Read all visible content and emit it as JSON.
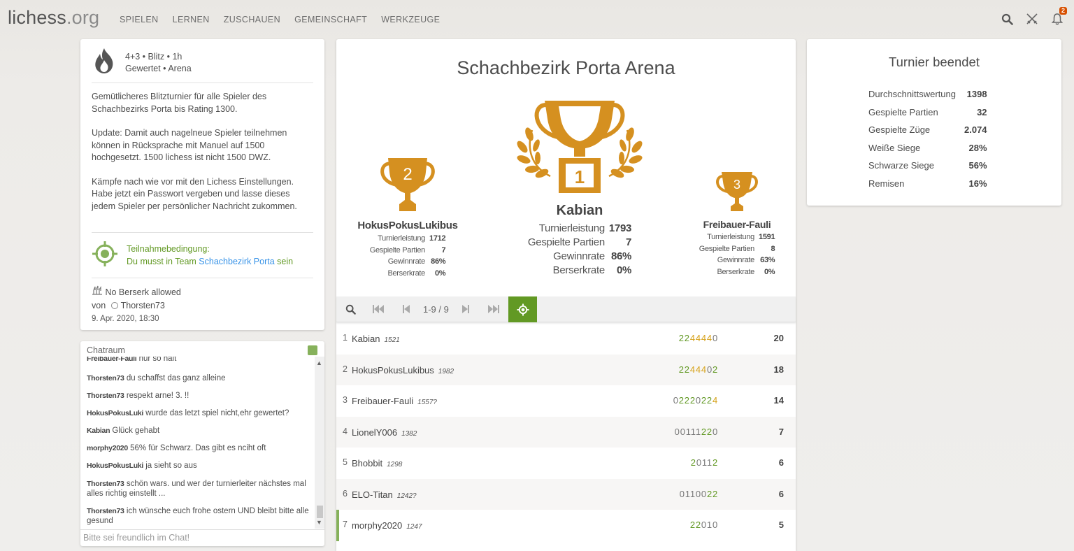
{
  "header": {
    "logo_main": "lichess",
    "logo_tld": ".org",
    "nav": [
      "SPIELEN",
      "LERNEN",
      "ZUSCHAUEN",
      "GEMEINSCHAFT",
      "WERKZEUGE"
    ],
    "notification_count": "2"
  },
  "info": {
    "line1": "4+3 • Blitz • 1h",
    "line2": "Gewertet • Arena",
    "desc1": "Gemütlicheres Blitzturnier für alle Spieler des Schachbezirks Porta bis Rating 1300.",
    "desc2": "Update: Damit auch nagelneue Spieler teilnehmen können in Rücksprache mit Manuel auf 1500 hochgesetzt. 1500 lichess ist nicht 1500 DWZ.",
    "desc3": "Kämpfe nach wie vor mit den Lichess Einstellungen. Habe jetzt ein Passwort vergeben und lasse dieses jedem Spieler per persönlicher Nachricht zukommen.",
    "condition_title": "Teilnahmebedingung:",
    "condition_prefix": "Du musst in Team",
    "condition_team": "Schachbezirk Porta",
    "condition_suffix": "sein",
    "berserk": "No Berserk allowed",
    "by_label": "von",
    "by_user": "Thorsten73",
    "date": "9. Apr. 2020, 18:30"
  },
  "chat": {
    "title": "Chatraum",
    "placeholder": "Bitte sei freundlich im Chat!",
    "messages": [
      {
        "user": "Freibauer-Fauli",
        "text": "nur so halt"
      },
      {
        "user": "Thorsten73",
        "text": "du schaffst das ganz alleine"
      },
      {
        "user": "Thorsten73",
        "text": "respekt arne! 3. !!"
      },
      {
        "user": "HokusPokusLuki",
        "text": "wurde das letzt spiel nicht,ehr gewertet?"
      },
      {
        "user": "Kabian",
        "text": "Glück gehabt"
      },
      {
        "user": "morphy2020",
        "text": "56% für Schwarz. Das gibt es nciht oft"
      },
      {
        "user": "HokusPokusLuki",
        "text": "ja sieht so aus"
      },
      {
        "user": "Thorsten73",
        "text": "schön wars. und wer der turnierleiter nächstes mal alles richtig einstellt ..."
      },
      {
        "user": "Thorsten73",
        "text": "ich wünsche euch frohe ostern UND bleibt bitte alle gesund"
      }
    ]
  },
  "tournament": {
    "name": "Schachbezirk Porta Arena",
    "labels": {
      "perf": "Turnierleistung",
      "games": "Gespielte Partien",
      "winrate": "Gewinnrate",
      "berserk": "Berserkrate"
    },
    "podium": {
      "first": {
        "rank": "1",
        "name": "Kabian",
        "perf": "1793",
        "games": "7",
        "winrate": "86%",
        "berserk": "0%"
      },
      "second": {
        "rank": "2",
        "name": "HokusPokusLukibus",
        "perf": "1712",
        "games": "7",
        "winrate": "86%",
        "berserk": "0%"
      },
      "third": {
        "rank": "3",
        "name": "Freibauer-Fauli",
        "perf": "1591",
        "games": "8",
        "winrate": "63%",
        "berserk": "0%"
      }
    },
    "pager": "1-9 / 9",
    "standings": [
      {
        "rank": "1",
        "name": "Kabian",
        "rating": "1521",
        "sheet": "2244440",
        "score": "20"
      },
      {
        "rank": "2",
        "name": "HokusPokusLukibus",
        "rating": "1982",
        "sheet": "2244402",
        "score": "18"
      },
      {
        "rank": "3",
        "name": "Freibauer-Fauli",
        "rating": "1557?",
        "sheet": "02220224",
        "score": "14"
      },
      {
        "rank": "4",
        "name": "LionelY006",
        "rating": "1382",
        "sheet": "00111220",
        "score": "7"
      },
      {
        "rank": "5",
        "name": "Bhobbit",
        "rating": "1298",
        "sheet": "20112",
        "score": "6"
      },
      {
        "rank": "6",
        "name": "ELO-Titan",
        "rating": "1242?",
        "sheet": "0110022",
        "score": "6"
      },
      {
        "rank": "7",
        "name": "morphy2020",
        "rating": "1247",
        "sheet": "22010",
        "score": "5"
      }
    ]
  },
  "stats": {
    "title": "Turnier beendet",
    "rows": [
      {
        "label": "Durchschnittswertung",
        "value": "1398"
      },
      {
        "label": "Gespielte Partien",
        "value": "32"
      },
      {
        "label": "Gespielte Züge",
        "value": "2.074"
      },
      {
        "label": "Weiße Siege",
        "value": "28%"
      },
      {
        "label": "Schwarze Siege",
        "value": "56%"
      },
      {
        "label": "Remisen",
        "value": "16%"
      }
    ]
  },
  "colors": {
    "accent_green": "#629924",
    "gold": "#d59020",
    "link_blue": "#3692e7",
    "badge": "#d85000"
  },
  "icons": [
    "search-icon",
    "swords-icon",
    "bell-icon",
    "fire-icon",
    "target-icon",
    "trophy-icon",
    "first-page-icon",
    "prev-page-icon",
    "next-page-icon",
    "last-page-icon",
    "berserk-icon"
  ]
}
